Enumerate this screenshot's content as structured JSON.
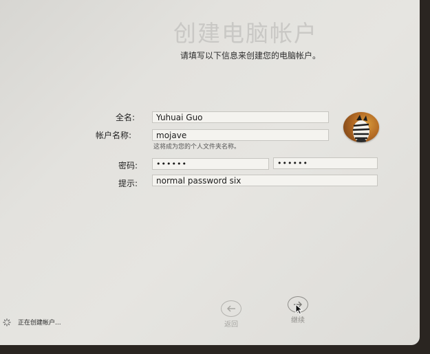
{
  "header": {
    "title": "创建电脑帐户",
    "subtitle": "请填写以下信息来创建您的电脑帐户。"
  },
  "form": {
    "full_name_label": "全名:",
    "full_name_value": "Yuhuai Guo",
    "account_name_label": "帐户名称:",
    "account_name_value": "mojave",
    "account_hint": "这将成为您的个人文件夹名称。",
    "password_label": "密码:",
    "password_value": "••••••",
    "verify_value": "••••••",
    "hint_label": "提示:",
    "hint_value": "normal password six"
  },
  "avatar": {
    "icon": "zebra-avatar"
  },
  "footer": {
    "status": "正在创建帐户...",
    "back_label": "返回",
    "continue_label": "继续"
  }
}
